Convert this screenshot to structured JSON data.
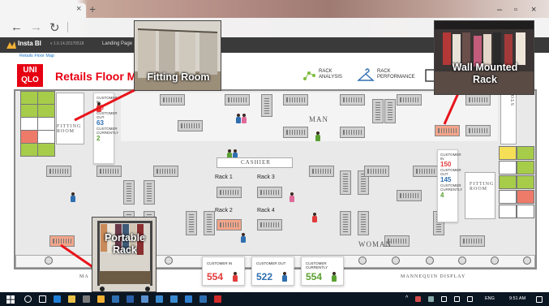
{
  "browser": {
    "tab_close": "×",
    "new_tab": "+",
    "nav_back": "←",
    "nav_forward": "→",
    "nav_reload": "↻",
    "win_min": "–",
    "win_max": "▫",
    "win_close": "×"
  },
  "app": {
    "name": "Insta BI",
    "version": "v 1.0.14.20170518",
    "nav_item": "Landing Page",
    "breadcrumb": "Retails Floor Map"
  },
  "toolbar": {
    "brand_line1": "UNI",
    "brand_line2": "QLO",
    "title": "Retails Floor Map",
    "rack_analysis": [
      "RACK",
      "ANALYSIS"
    ],
    "rack_performance": [
      "RACK",
      "PERFORMANCE"
    ]
  },
  "floor": {
    "labels": {
      "fitting_room_left": [
        "FITTING",
        "ROOM"
      ],
      "fitting_room_right": [
        "FITTING",
        "ROOM"
      ],
      "man": "MAN",
      "woman": "WOMAN",
      "cashier": "CASHIER",
      "store": "STORE",
      "mannequin": "MANNEQUIN DISPLAY",
      "ma": "MA"
    },
    "rack_labels": [
      "Rack 1",
      "Rack 3",
      "Rack 2",
      "Rack 4"
    ],
    "left_counter": {
      "in_label": "CUSTOMER IN",
      "in_value": "63",
      "out_label": "CUSTOMER OUT",
      "out_value": "63",
      "current_label": "CUSTOMER CURRENTLY",
      "current_value": "2"
    },
    "right_counter": {
      "in_label": "CUSTOMER IN",
      "in_value": "150",
      "out_label": "CUSTOMER OUT",
      "out_value": "145",
      "current_label": "CUSTOMER CURRENTLY",
      "current_value": "4"
    }
  },
  "stats": [
    {
      "title": "CUSTOMER IN",
      "value": "554",
      "color": "#e23b3b"
    },
    {
      "title": "CUSTOMER OUT",
      "value": "522",
      "color": "#2f6fb0"
    },
    {
      "title": "CUSTOMER CURRENTLY",
      "value": "554",
      "color": "#5aa032"
    }
  ],
  "overlays": {
    "fitting_room": "Fitting Room",
    "wall_mounted_line1": "Wall Mounted",
    "wall_mounted_line2": "Rack",
    "portable_line1": "Portable",
    "portable_line2": "Rack"
  },
  "taskbar": {
    "lang": "ENG",
    "time": "9:51 AM"
  }
}
